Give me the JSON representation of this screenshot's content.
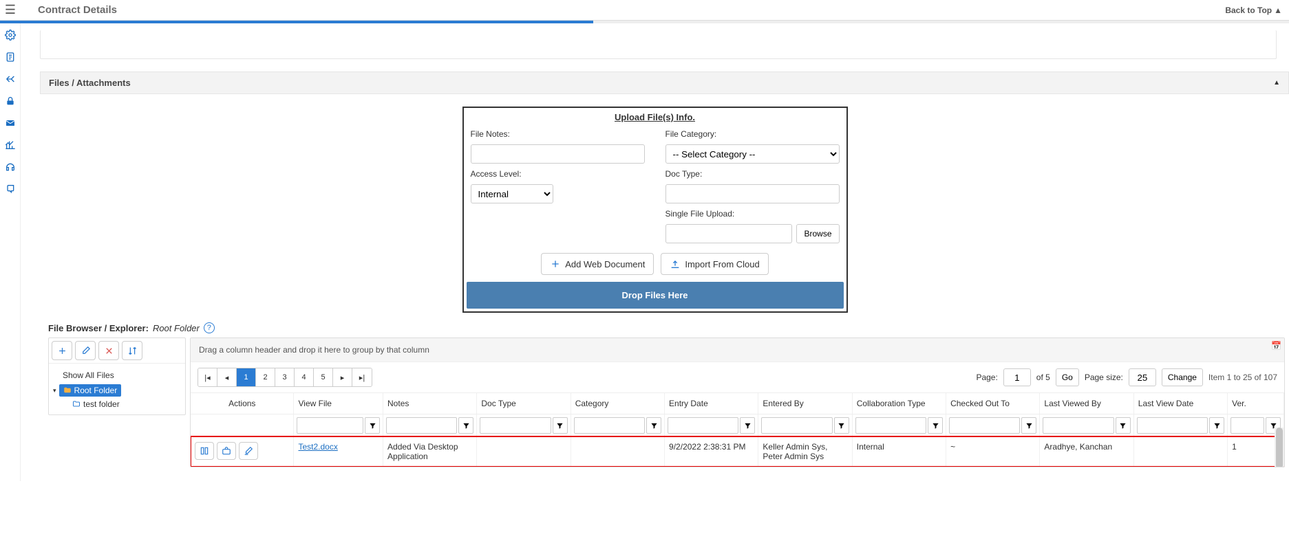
{
  "header": {
    "title": "Contract Details",
    "back_to_top": "Back to Top"
  },
  "section": {
    "title": "Files / Attachments"
  },
  "upload": {
    "heading": "Upload File(s) Info.",
    "file_notes_label": "File Notes:",
    "access_level_label": "Access Level:",
    "access_level_value": "Internal",
    "file_category_label": "File Category:",
    "file_category_placeholder": "-- Select Category --",
    "doc_type_label": "Doc Type:",
    "single_file_label": "Single File Upload:",
    "browse": "Browse",
    "add_web_doc": "Add Web Document",
    "import_cloud": "Import From Cloud",
    "drop_zone": "Drop Files Here"
  },
  "browser": {
    "label_prefix": "File Browser / Explorer:",
    "current_folder": "Root Folder",
    "show_all": "Show All Files",
    "root": "Root Folder",
    "subfolder": "test folder"
  },
  "grid": {
    "hint": "Drag a column header and drop it here to group by that column",
    "page_label": "Page:",
    "page_value": "1",
    "of_pages": "of 5",
    "go": "Go",
    "page_size_label": "Page size:",
    "page_size_value": "25",
    "change": "Change",
    "item_count": "Item 1 to 25 of 107",
    "pages": [
      "1",
      "2",
      "3",
      "4",
      "5"
    ],
    "columns": {
      "actions": "Actions",
      "view_file": "View File",
      "notes": "Notes",
      "doc_type": "Doc Type",
      "category": "Category",
      "entry_date": "Entry Date",
      "entered_by": "Entered By",
      "collab_type": "Collaboration Type",
      "checked_out_to": "Checked Out To",
      "last_viewed_by": "Last Viewed By",
      "last_view_date": "Last View Date",
      "ver": "Ver."
    },
    "row": {
      "file": "Test2.docx",
      "notes": "Added Via Desktop Application",
      "doc_type": "",
      "category": "",
      "entry_date": "9/2/2022 2:38:31 PM",
      "entered_by": "Keller Admin Sys, Peter Admin Sys",
      "collab_type": "Internal",
      "checked_out_to": "~",
      "last_viewed_by": "Aradhye, Kanchan",
      "last_view_date": "",
      "ver": "1"
    }
  }
}
